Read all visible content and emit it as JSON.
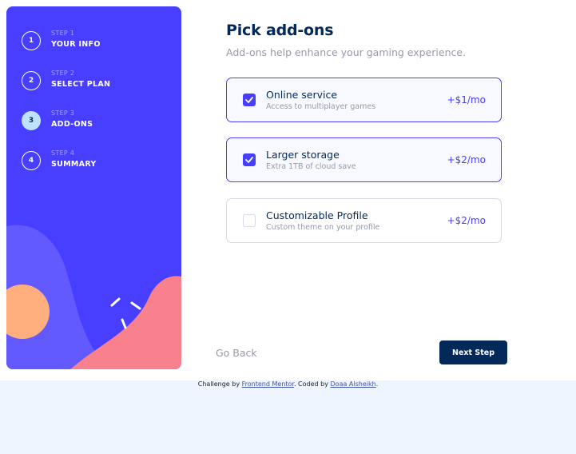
{
  "colors": {
    "primary": "#483eff",
    "marine_blue": "#02295a",
    "light_blue": "#bee2fd",
    "cool_gray": "#9699ab",
    "light_gray": "#d6d9e6",
    "page_bg": "#eff5ff",
    "orange": "#ffaf7e",
    "pink": "#f9818e"
  },
  "steps": [
    {
      "label": "STEP 1",
      "title": "YOUR INFO",
      "number": "1",
      "active": false
    },
    {
      "label": "STEP 2",
      "title": "SELECT PLAN",
      "number": "2",
      "active": false
    },
    {
      "label": "STEP 3",
      "title": "ADD-ONS",
      "number": "3",
      "active": true
    },
    {
      "label": "STEP 4",
      "title": "SUMMARY",
      "number": "4",
      "active": false
    }
  ],
  "main": {
    "title": "Pick add-ons",
    "subtitle": "Add-ons help enhance your gaming experience."
  },
  "addons": [
    {
      "name": "Online service",
      "description": "Access to multiplayer games",
      "price": "+$1/mo",
      "checked": true
    },
    {
      "name": "Larger storage",
      "description": "Extra 1TB of cloud save",
      "price": "+$2/mo",
      "checked": true
    },
    {
      "name": "Customizable Profile",
      "description": "Custom theme on your profile",
      "price": "+$2/mo",
      "checked": false
    }
  ],
  "nav": {
    "back_label": "Go Back",
    "next_label": "Next Step"
  },
  "footer": {
    "prefix": "Challenge by ",
    "link1": "Frontend Mentor",
    "middle": ". Coded by ",
    "link2": "Doaa Alsheikh",
    "suffix": "."
  }
}
